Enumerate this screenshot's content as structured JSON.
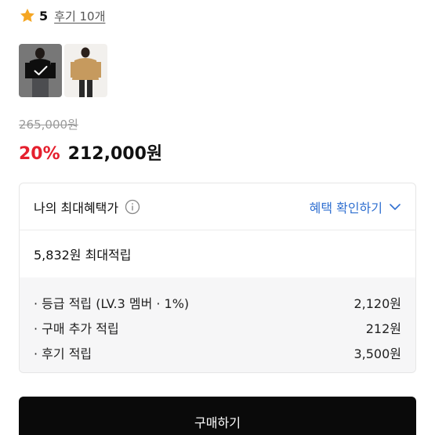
{
  "rating": {
    "score": "5",
    "review_link": "후기 10개",
    "star_icon": "star-icon",
    "star_color": "#f5a623"
  },
  "thumbnails": [
    {
      "name": "thumbnail-black-jacket",
      "selected": true,
      "icon": "checkmark-icon"
    },
    {
      "name": "thumbnail-tan-jacket",
      "selected": false
    }
  ],
  "price": {
    "original": "265,000원",
    "discount": "20%",
    "sale": "212,000원",
    "discount_color": "#e5202e"
  },
  "benefits": {
    "title": "나의 최대혜택가",
    "info_icon": "info-icon",
    "toggle_label": "혜택 확인하기",
    "toggle_icon": "chevron-down-icon",
    "summary": "5,832원 최대적립",
    "accent_color": "#2f6fd0",
    "items": [
      {
        "label": "등급 적립 (LV.3 멤버 · 1%)",
        "value": "2,120원"
      },
      {
        "label": "구매 추가 적립",
        "value": "212원"
      },
      {
        "label": "후기 적립",
        "value": "3,500원"
      }
    ]
  },
  "buy_button": {
    "label": "구매하기"
  }
}
